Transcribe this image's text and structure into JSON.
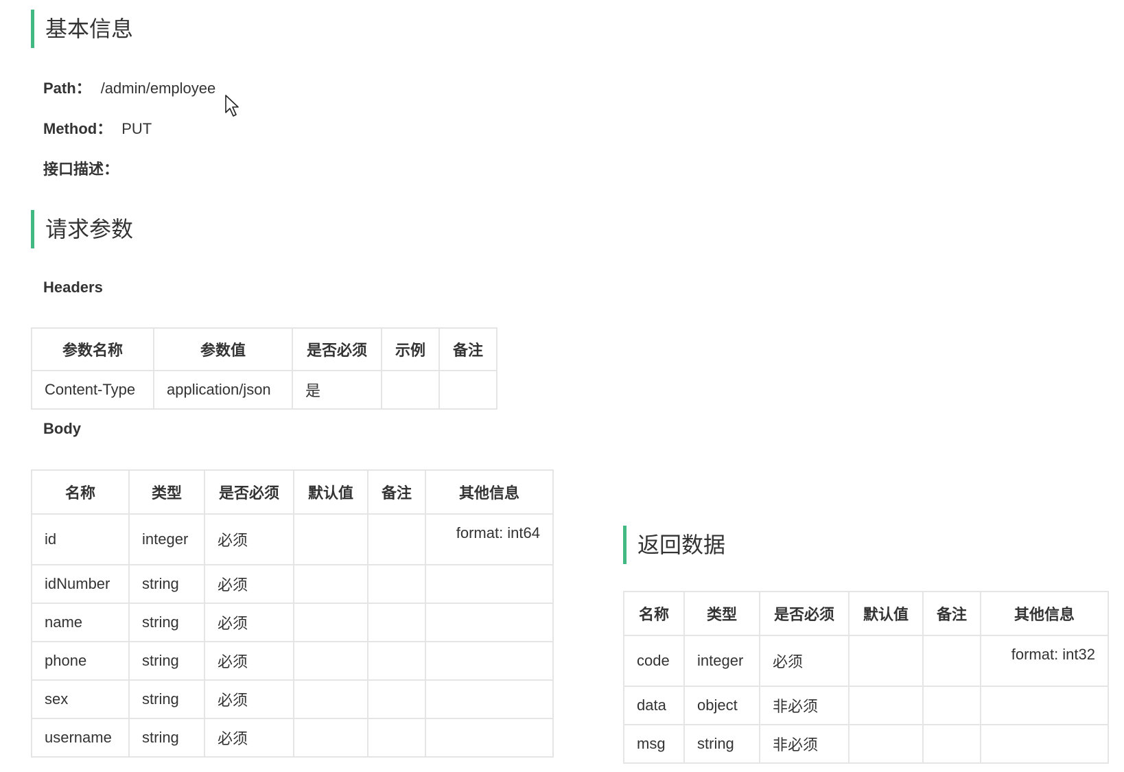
{
  "basic_info": {
    "title": "基本信息",
    "path_label": "Path：",
    "path_value": "/admin/employee",
    "method_label": "Method：",
    "method_value": "PUT",
    "desc_label": "接口描述："
  },
  "request_params": {
    "title": "请求参数",
    "headers_label": "Headers",
    "headers_columns": [
      "参数名称",
      "参数值",
      "是否必须",
      "示例",
      "备注"
    ],
    "headers_rows": [
      [
        "Content-Type",
        "application/json",
        "是",
        "",
        ""
      ]
    ],
    "body_label": "Body",
    "body_columns": [
      "名称",
      "类型",
      "是否必须",
      "默认值",
      "备注",
      "其他信息"
    ],
    "body_rows": [
      [
        "id",
        "integer",
        "必须",
        "",
        "",
        "format: int64"
      ],
      [
        "idNumber",
        "string",
        "必须",
        "",
        "",
        ""
      ],
      [
        "name",
        "string",
        "必须",
        "",
        "",
        ""
      ],
      [
        "phone",
        "string",
        "必须",
        "",
        "",
        ""
      ],
      [
        "sex",
        "string",
        "必须",
        "",
        "",
        ""
      ],
      [
        "username",
        "string",
        "必须",
        "",
        "",
        ""
      ]
    ]
  },
  "response_data": {
    "title": "返回数据",
    "columns": [
      "名称",
      "类型",
      "是否必须",
      "默认值",
      "备注",
      "其他信息"
    ],
    "rows": [
      [
        "code",
        "integer",
        "必须",
        "",
        "",
        "format: int32"
      ],
      [
        "data",
        "object",
        "非必须",
        "",
        "",
        ""
      ],
      [
        "msg",
        "string",
        "非必须",
        "",
        "",
        ""
      ]
    ]
  },
  "colors": {
    "accent": "#42b983",
    "border": "#e5e5e5",
    "text": "#333333"
  }
}
